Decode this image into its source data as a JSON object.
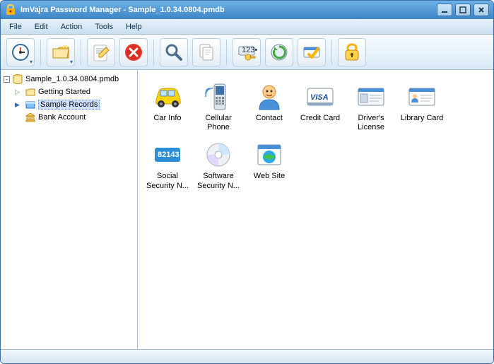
{
  "window": {
    "title": "ImVajra Password Manager - Sample_1.0.34.0804.pmdb"
  },
  "menu": {
    "file": "File",
    "edit": "Edit",
    "action": "Action",
    "tools": "Tools",
    "help": "Help"
  },
  "tree": {
    "root": {
      "label": "Sample_1.0.34.0804.pmdb",
      "expander": "-"
    },
    "children": [
      {
        "label": "Getting Started",
        "expander": "▷"
      },
      {
        "label": "Sample Records",
        "expander": "▶",
        "selected": true
      },
      {
        "label": "Bank Account",
        "expander": ""
      }
    ]
  },
  "items": [
    {
      "label": "Car Info",
      "icon": "car"
    },
    {
      "label": "Cellular Phone",
      "icon": "phone"
    },
    {
      "label": "Contact",
      "icon": "contact"
    },
    {
      "label": "Credit Card",
      "icon": "creditcard"
    },
    {
      "label": "Driver's License",
      "icon": "license"
    },
    {
      "label": "Library Card",
      "icon": "library"
    },
    {
      "label": "Social Security N...",
      "icon": "ssn",
      "badge": "82143"
    },
    {
      "label": "Software Security N...",
      "icon": "disc"
    },
    {
      "label": "Web Site",
      "icon": "web"
    }
  ]
}
